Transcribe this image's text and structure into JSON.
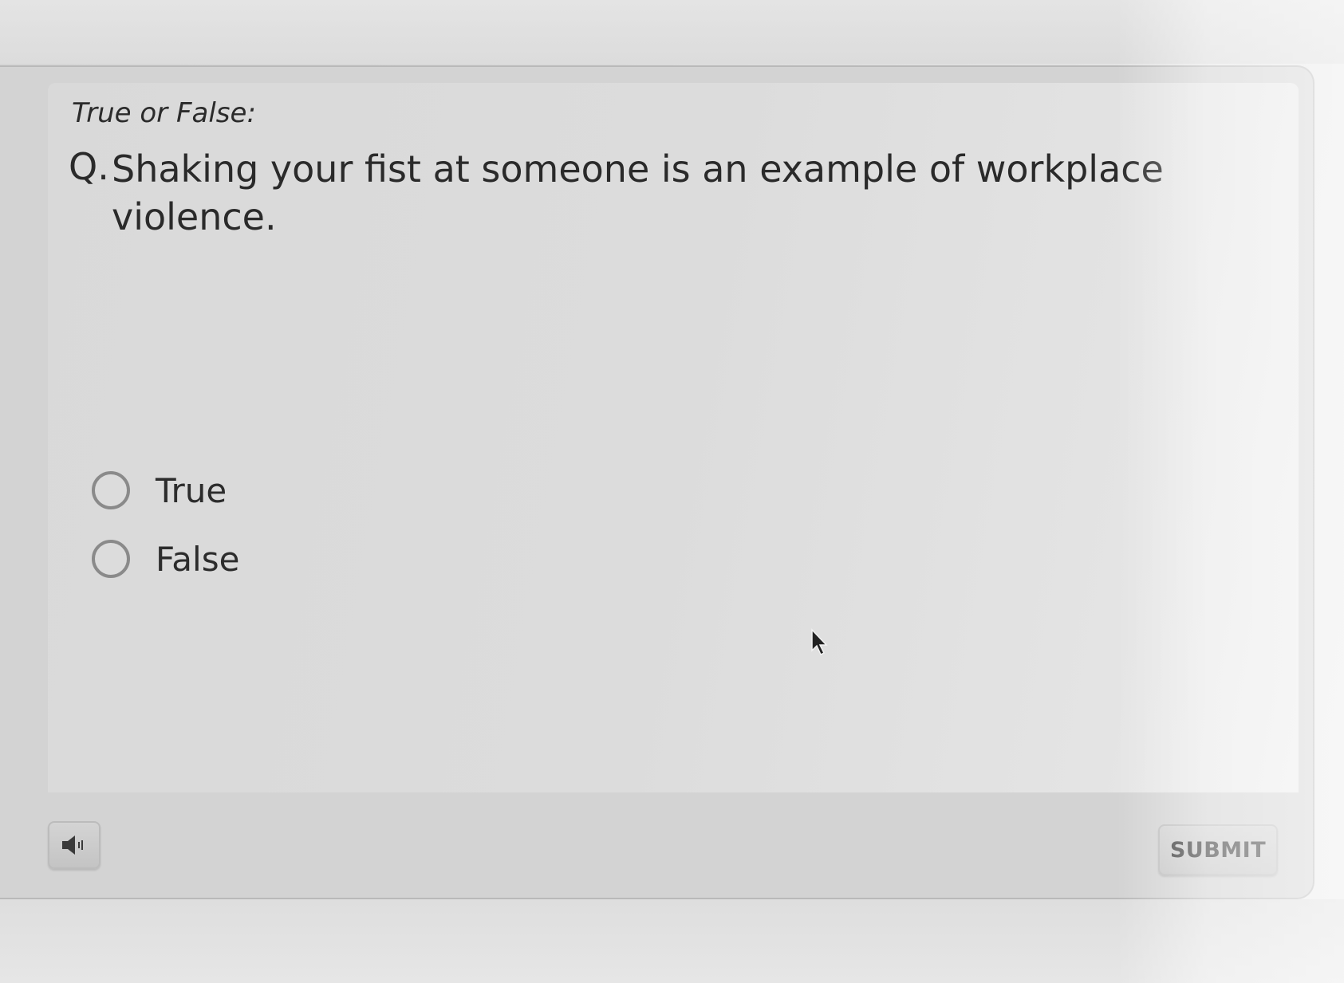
{
  "question": {
    "type_label": "True or False:",
    "prefix": "Q.",
    "text": "Shaking your fist at someone is an example of workplace violence."
  },
  "options": [
    {
      "label": "True",
      "selected": false
    },
    {
      "label": "False",
      "selected": false
    }
  ],
  "footer": {
    "audio_icon": "speaker-icon",
    "submit_label": "SUBMIT"
  },
  "colors": {
    "panel": "#d9d9d9",
    "text": "#2a2a2a",
    "radio_border": "#8a8a8a"
  }
}
